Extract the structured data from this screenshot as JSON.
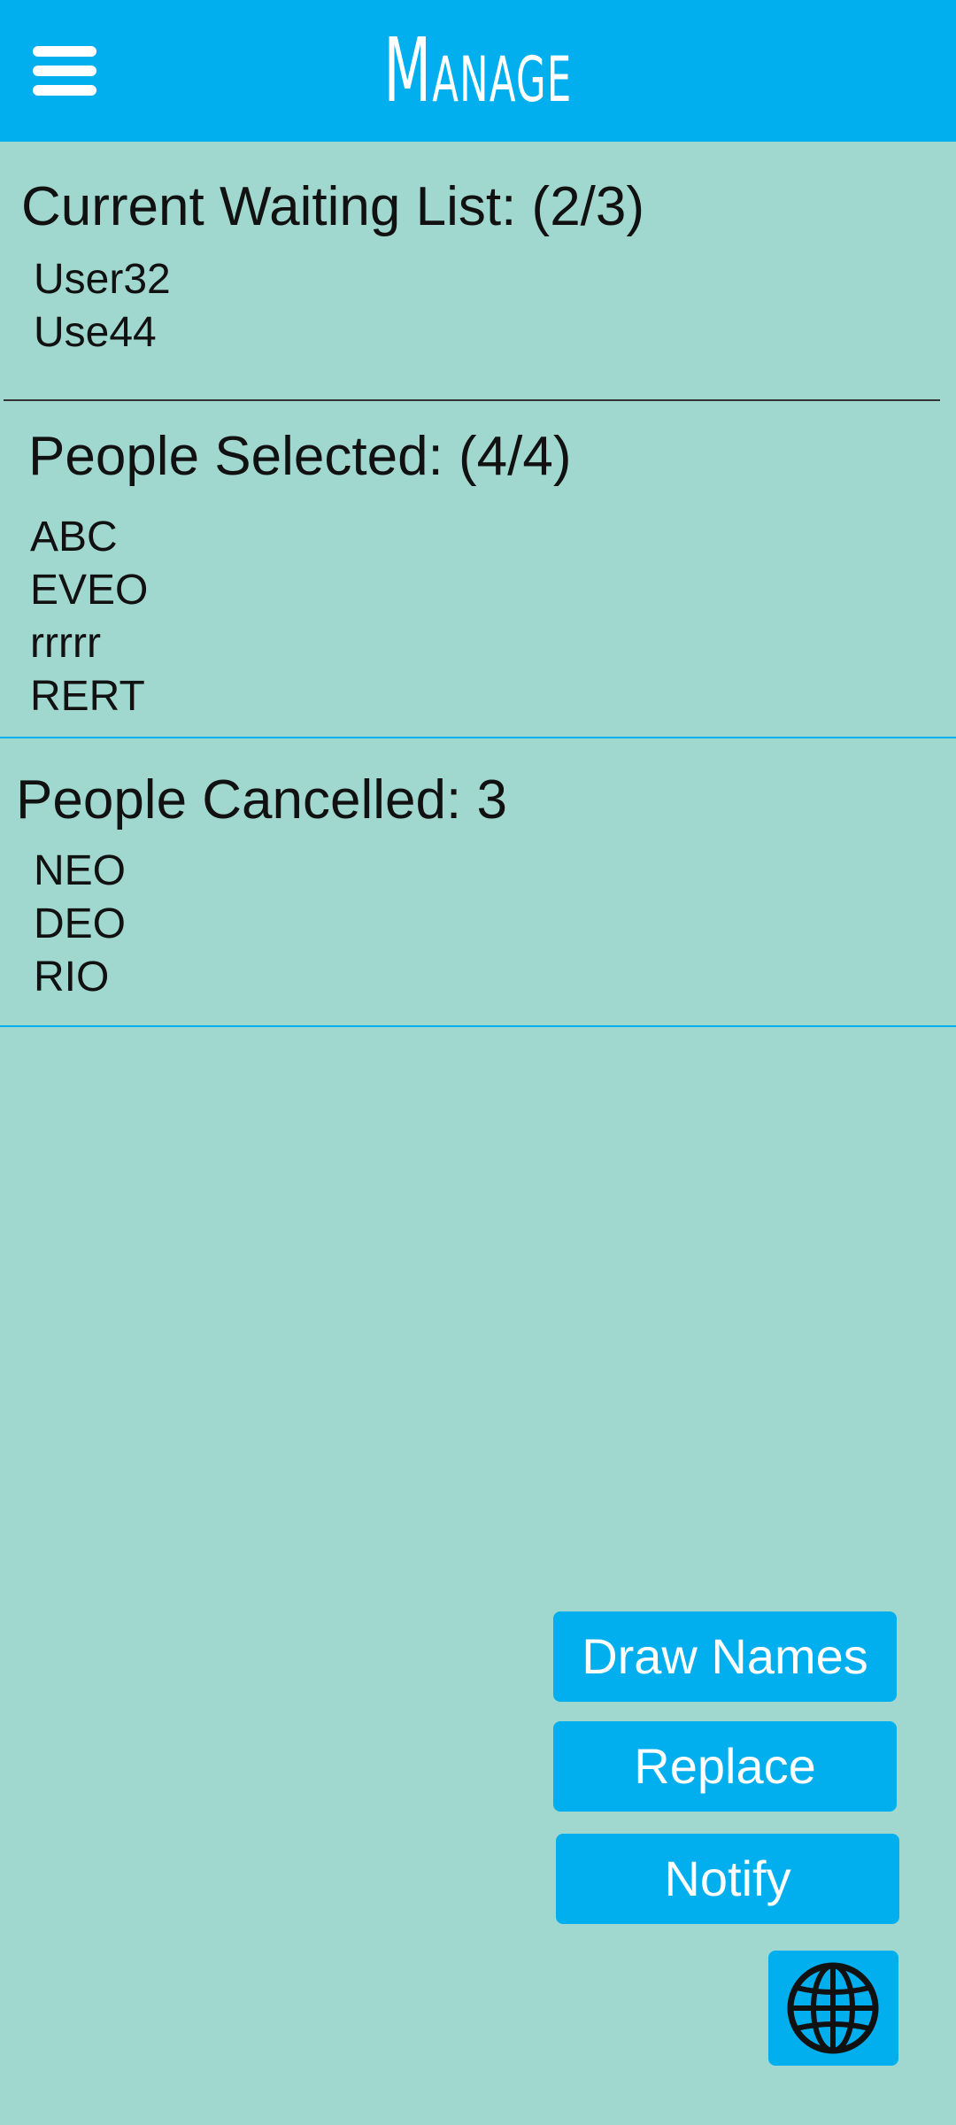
{
  "app_bar": {
    "title": "Manage",
    "menu_icon": "hamburger-menu-icon",
    "background_color": "#01aeee"
  },
  "waiting_list": {
    "heading": "Current Waiting List: (2/3)",
    "items": [
      "User32",
      "Use44"
    ]
  },
  "selected": {
    "heading": "People Selected: (4/4)",
    "items": [
      "ABC",
      "EVEO",
      "rrrrr",
      "RERT"
    ]
  },
  "cancelled": {
    "heading": "People Cancelled: 3",
    "items": [
      "NEO",
      "DEO",
      "RIO"
    ]
  },
  "actions": {
    "draw_names_label": "Draw Names",
    "replace_label": "Replace",
    "notify_label": "Notify",
    "globe_icon": "globe-icon"
  },
  "colors": {
    "background": "#a0d8cf",
    "accent": "#01aeee",
    "divider_dark": "#333333",
    "divider_accent": "#01aeee"
  }
}
